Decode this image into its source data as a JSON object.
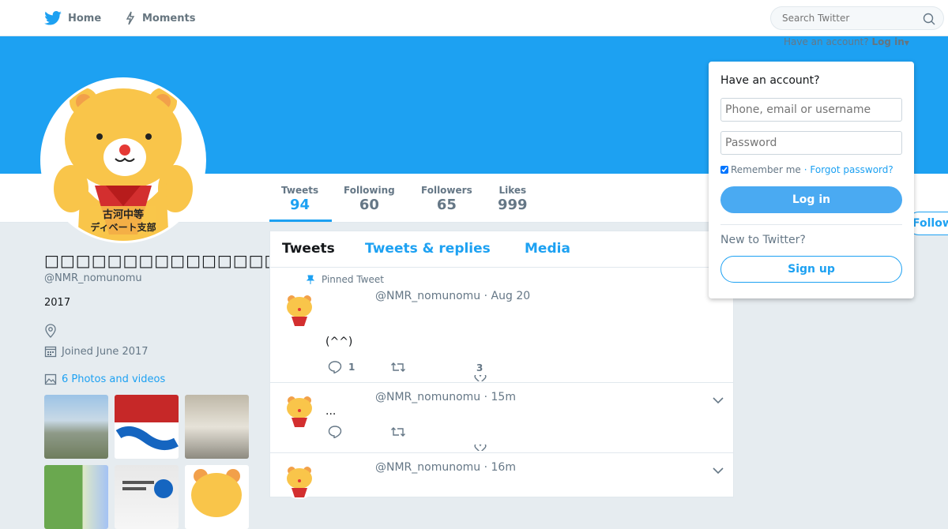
{
  "nav": {
    "home_label": "Home",
    "moments_label": "Moments",
    "search_placeholder": "Search Twitter"
  },
  "account_prompt": {
    "text": "Have an account?",
    "login_label": "Log in"
  },
  "profile": {
    "display_name": "□□□□□□□□□□□□□□□□□",
    "handle": "@NMR_nomunomu",
    "bio": "2017",
    "joined": "Joined June 2017",
    "photos_link": "6 Photos and videos",
    "avatar_text_line1": "古河中等",
    "avatar_text_line2": "ディベート支部",
    "follow_label": "Follow"
  },
  "stats": [
    {
      "label": "Tweets",
      "value": "94"
    },
    {
      "label": "Following",
      "value": "60"
    },
    {
      "label": "Followers",
      "value": "65"
    },
    {
      "label": "Likes",
      "value": "999"
    }
  ],
  "tabs": [
    {
      "label": "Tweets"
    },
    {
      "label": "Tweets & replies"
    },
    {
      "label": "Media"
    }
  ],
  "tweets": [
    {
      "pinned": "Pinned Tweet",
      "meta": "@NMR_nomunomu · Aug 20",
      "text": "(^^)",
      "replies": "1",
      "likes": "3"
    },
    {
      "meta": "@NMR_nomunomu · 15m",
      "text": "..."
    },
    {
      "meta": "@NMR_nomunomu · 16m",
      "text": ""
    }
  ],
  "login": {
    "title": "Have an account?",
    "username_placeholder": "Phone, email or username",
    "password_placeholder": "Password",
    "remember": "Remember me",
    "forgot": "· Forgot password?",
    "login_button": "Log in",
    "new_to_twitter": "New to Twitter?",
    "signup_button": "Sign up"
  },
  "colors": {
    "brand": "#1da1f2",
    "background": "#e6ecf0"
  }
}
